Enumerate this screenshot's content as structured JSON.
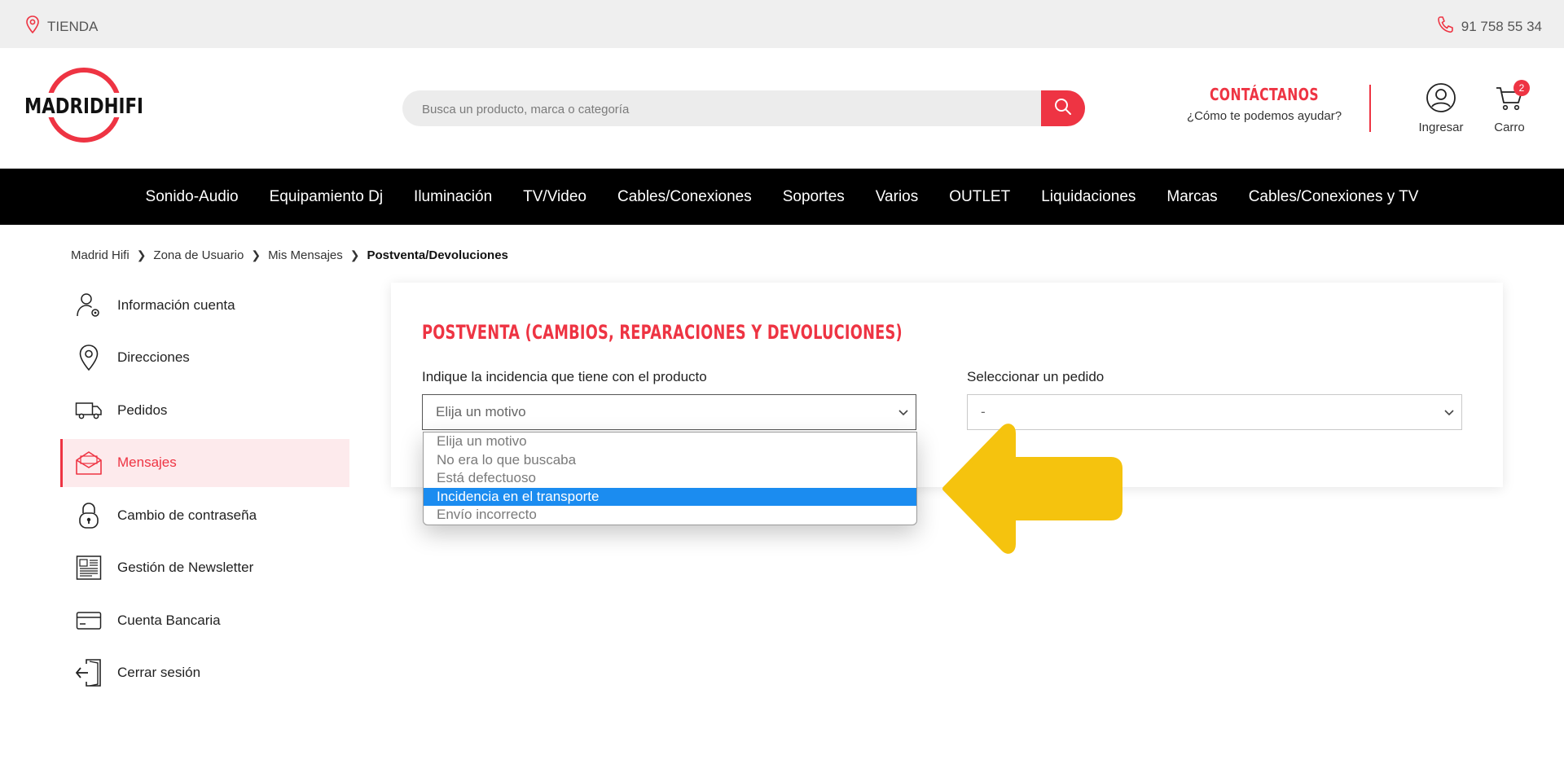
{
  "topbar": {
    "store_label": "TIENDA",
    "phone": "91 758 55 34"
  },
  "header": {
    "logo_text": "MADRIDHIFI",
    "search_placeholder": "Busca un producto, marca o categoría",
    "contact_title": "CONTÁCTANOS",
    "contact_subtitle": "¿Cómo te podemos ayudar?",
    "account_label": "Ingresar",
    "cart_label": "Carro",
    "cart_count": "2"
  },
  "nav": {
    "items": [
      "Sonido-Audio",
      "Equipamiento Dj",
      "Iluminación",
      "TV/Video",
      "Cables/Conexiones",
      "Soportes",
      "Varios",
      "OUTLET",
      "Liquidaciones",
      "Marcas",
      "Cables/Conexiones y TV"
    ]
  },
  "breadcrumb": {
    "items": [
      "Madrid Hifi",
      "Zona de Usuario",
      "Mis Mensajes"
    ],
    "current": "Postventa/Devoluciones"
  },
  "sidebar": {
    "items": [
      {
        "label": "Información cuenta",
        "icon": "user-gear-icon"
      },
      {
        "label": "Direcciones",
        "icon": "location-pin-icon"
      },
      {
        "label": "Pedidos",
        "icon": "truck-icon"
      },
      {
        "label": "Mensajes",
        "icon": "envelope-open-icon",
        "active": true
      },
      {
        "label": "Cambio de contraseña",
        "icon": "padlock-icon"
      },
      {
        "label": "Gestión de Newsletter",
        "icon": "newspaper-icon"
      },
      {
        "label": "Cuenta Bancaria",
        "icon": "credit-card-icon"
      },
      {
        "label": "Cerrar sesión",
        "icon": "logout-door-icon"
      }
    ]
  },
  "main": {
    "title": "POSTVENTA (CAMBIOS, REPARACIONES Y DEVOLUCIONES)",
    "reason_label": "Indique la incidencia que tiene con el producto",
    "reason_value": "Elija un motivo",
    "order_label": "Seleccionar un pedido",
    "order_value": "-",
    "reason_options": [
      "Elija un motivo",
      "No era lo que buscaba",
      "Está defectuoso",
      "Incidencia en el transporte",
      "Envío incorrecto"
    ],
    "highlighted_option": "Incidencia en el transporte"
  },
  "colors": {
    "accent": "#ee3443",
    "highlight": "#1b8cf0",
    "arrow": "#f5c30e",
    "nav_bg": "#000000"
  }
}
